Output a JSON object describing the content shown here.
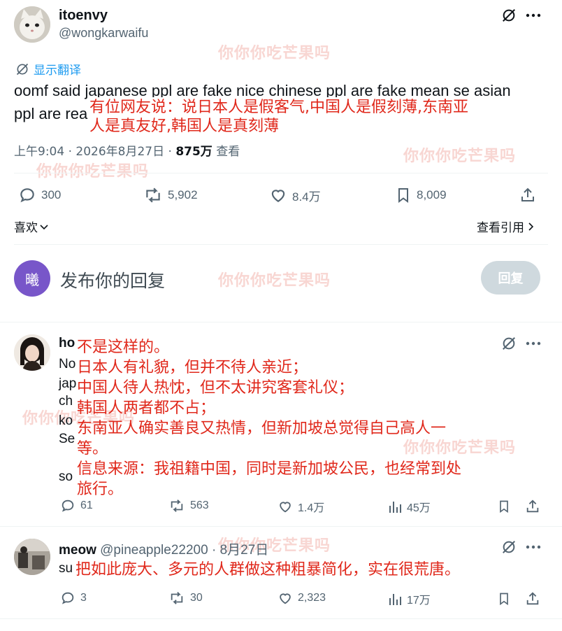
{
  "watermark": "你你你吃芒果吗",
  "colors": {
    "accent": "#1d9bf0",
    "overlay_red": "#e0281b",
    "muted": "#536471",
    "reply_button": "#cfd9de",
    "avatar_purple": "#7856c9"
  },
  "main_post": {
    "display_name": "itoenvy",
    "handle": "@wongkarwaifu",
    "translate_label": "显示翻译",
    "text_line1": "oomf said japanese ppl are fake nice chinese ppl are fake mean se asian",
    "text_line2": "ppl are rea",
    "translation_line1": "有位网友说：说日本人是假客气,中国人是假刻薄,东南亚",
    "translation_line2": "人是真友好,韩国人是真刻薄",
    "time": "上午9:04 · 2026年8月27日 · ",
    "views_count": "875万",
    "views_label": " 查看",
    "stats": {
      "replies": "300",
      "reposts": "5,902",
      "likes": "8.4万",
      "bookmarks": "8,009"
    },
    "like_label": "喜欢",
    "quote_label": "查看引用"
  },
  "composer": {
    "avatar_char": "曦",
    "placeholder": "发布你的回复",
    "reply_button": "回复"
  },
  "replies": [
    {
      "name_partial": "ho",
      "text_fragments": [
        "No",
        "jap",
        "ch",
        "ko",
        "Se",
        "so"
      ],
      "translation": [
        "不是这样的。",
        "日本人有礼貌，但并不待人亲近；",
        "中国人待人热忱，但不太讲究客套礼仪；",
        "韩国人两者都不占；",
        "东南亚人确实善良又热情，但新加坡总觉得自己高人一",
        "等。",
        "信息来源：我祖籍中国，同时是新加坡公民，也经常到处",
        "旅行。"
      ],
      "stats": {
        "replies": "61",
        "reposts": "563",
        "likes": "1.4万",
        "views": "45万"
      }
    },
    {
      "display_name": "meow",
      "handle": "@pineapple22200",
      "date": " · 8月27日",
      "text_fragment": "su",
      "translation": "把如此庞大、多元的人群做这种粗暴简化，实在很荒唐。",
      "stats": {
        "replies": "3",
        "reposts": "30",
        "likes": "2,323",
        "views": "17万"
      }
    }
  ]
}
